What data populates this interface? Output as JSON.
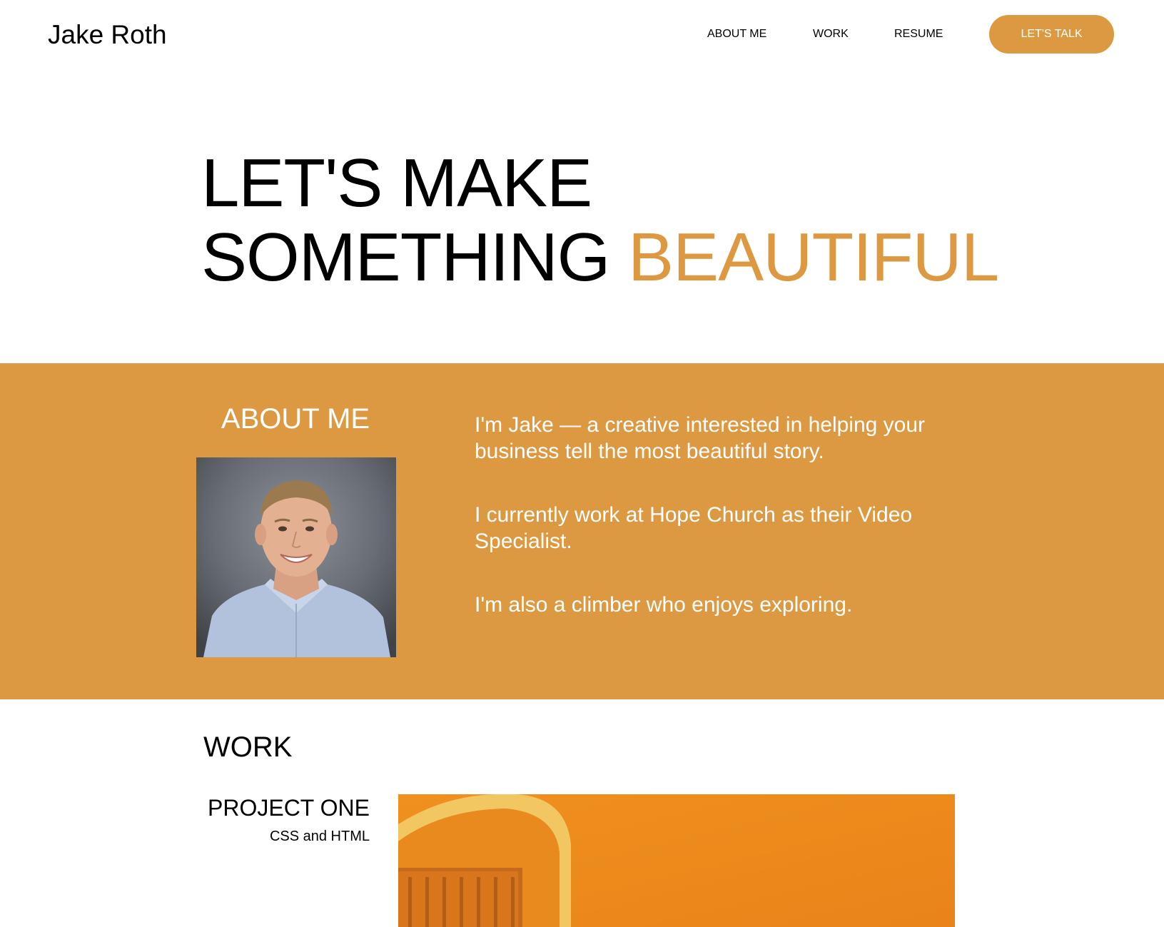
{
  "header": {
    "logo": "Jake Roth",
    "nav": [
      {
        "label": "ABOUT ME"
      },
      {
        "label": "WORK"
      },
      {
        "label": "RESUME"
      }
    ],
    "cta_label": "LET'S TALK"
  },
  "hero": {
    "line1": "LET'S MAKE",
    "line2_prefix": "SOMETHING ",
    "line2_accent": "BEAUTIFUL"
  },
  "about": {
    "title": "ABOUT ME",
    "paragraphs": [
      "I'm Jake — a creative interested in helping your business tell the most beautiful story.",
      "I currently work at Hope Church as their Video Specialist.",
      "I'm also a climber who enjoys exploring."
    ]
  },
  "work": {
    "title": "WORK",
    "projects": [
      {
        "title": "PROJECT ONE",
        "subtitle": "CSS and HTML"
      }
    ]
  },
  "colors": {
    "accent": "#dd9941",
    "text": "#000000",
    "background": "#ffffff",
    "on_accent": "#ffffff"
  }
}
